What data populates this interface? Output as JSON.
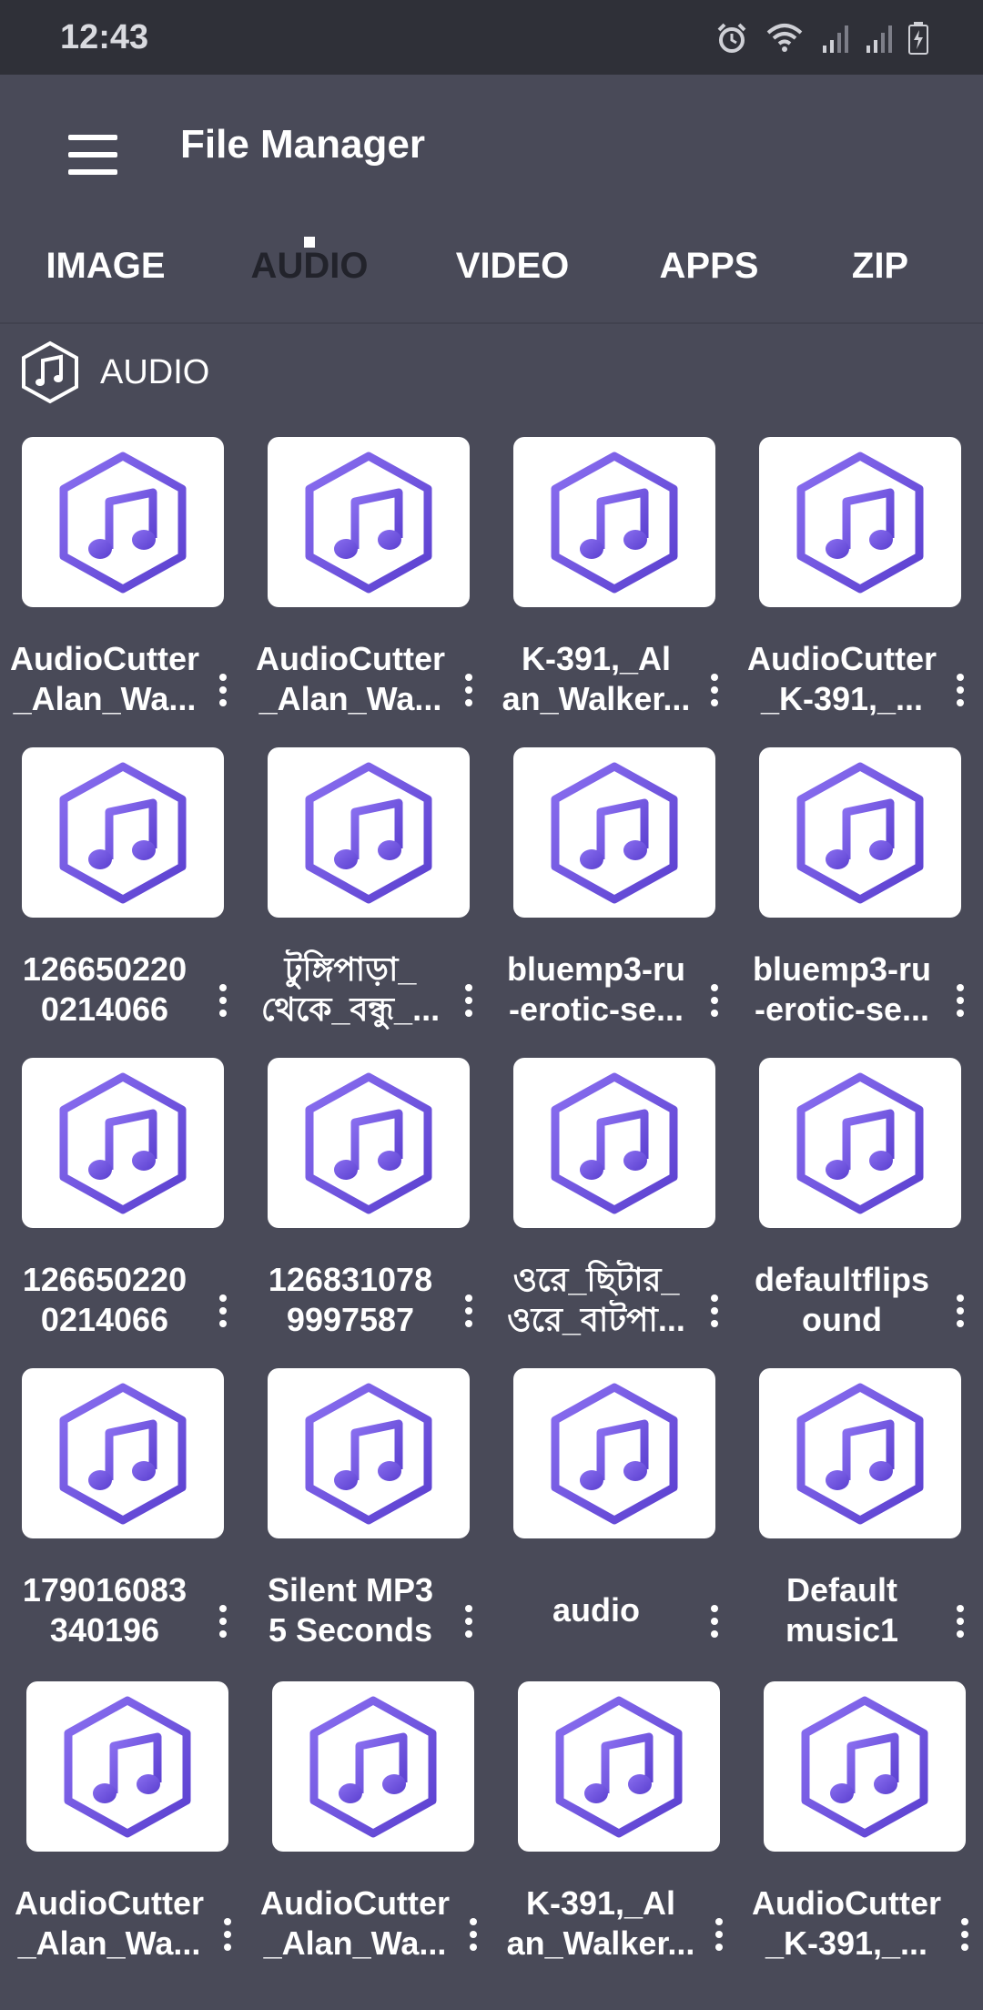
{
  "status": {
    "time": "12:43",
    "icons": [
      "alarm-icon",
      "wifi-icon",
      "signal-icon",
      "signal-icon-2",
      "battery-charging-icon"
    ]
  },
  "appbar": {
    "title": "File Manager",
    "menu_icon": "hamburger-menu-icon"
  },
  "tabs": [
    {
      "label": "IMAGE",
      "active": false
    },
    {
      "label": "AUDIO",
      "active": true
    },
    {
      "label": "VIDEO",
      "active": false
    },
    {
      "label": "APPS",
      "active": false
    },
    {
      "label": "ZIP",
      "active": false
    }
  ],
  "section": {
    "title": "AUDIO",
    "icon": "music-note-hexagon-icon"
  },
  "colors": {
    "background": "#494a58",
    "statusbar": "#2f3038",
    "icon_purple": "#6a4fd8",
    "icon_purple_light": "#8a6ff0"
  },
  "files": [
    {
      "line1": "AudioCutter",
      "line2": "_Alan_Wa..."
    },
    {
      "line1": "AudioCutter",
      "line2": "_Alan_Wa..."
    },
    {
      "line1": "K-391,_Al",
      "line2": "an_Walker..."
    },
    {
      "line1": "AudioCutter",
      "line2": "_K-391,_..."
    },
    {
      "line1": "126650220",
      "line2": "0214066"
    },
    {
      "line1": "টুঙ্গিপাড়া_",
      "line2": "থেকে_বন্ধু_..."
    },
    {
      "line1": "bluemp3-ru",
      "line2": "-erotic-se..."
    },
    {
      "line1": "bluemp3-ru",
      "line2": "-erotic-se..."
    },
    {
      "line1": "126650220",
      "line2": "0214066"
    },
    {
      "line1": "126831078",
      "line2": "9997587"
    },
    {
      "line1": "ওরে_ছিটার_",
      "line2": "ওরে_বাটপা..."
    },
    {
      "line1": "defaultflips",
      "line2": "ound"
    },
    {
      "line1": "179016083",
      "line2": "340196"
    },
    {
      "line1": "Silent MP3",
      "line2": "5 Seconds"
    },
    {
      "line1": "audio",
      "line2": ""
    },
    {
      "line1": "Default",
      "line2": "music1"
    },
    {
      "line1": "AudioCutter",
      "line2": "_Alan_Wa..."
    },
    {
      "line1": "AudioCutter",
      "line2": "_Alan_Wa..."
    },
    {
      "line1": "K-391,_Al",
      "line2": "an_Walker..."
    },
    {
      "line1": "AudioCutter",
      "line2": "_K-391,_..."
    }
  ]
}
